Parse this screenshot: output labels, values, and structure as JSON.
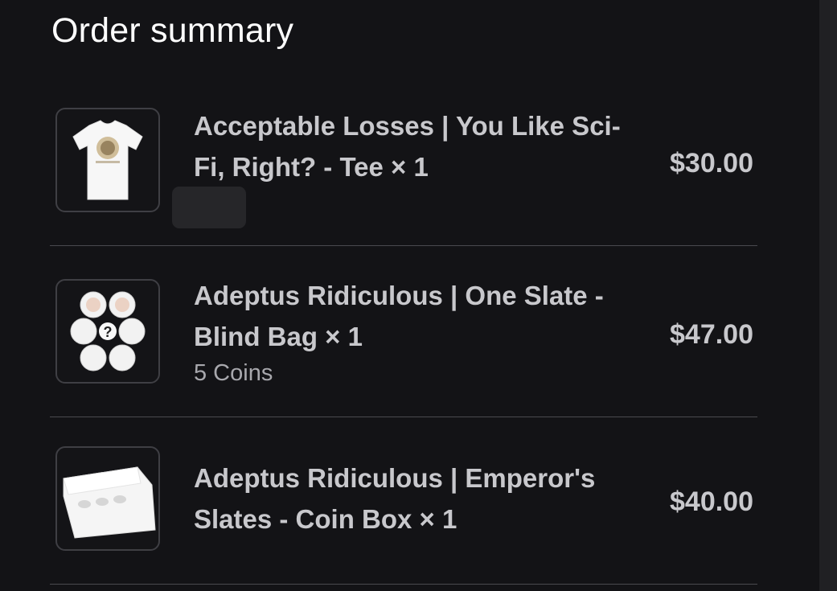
{
  "summary": {
    "title": "Order summary"
  },
  "items": [
    {
      "name": "Acceptable Losses | You Like Sci-Fi, Right? - Tee × 1",
      "variant": "",
      "price": "$30.00",
      "image_icon": "tshirt-image"
    },
    {
      "name": "Adeptus Ridiculous | One Slate - Blind Bag × 1",
      "variant": "5 Coins",
      "price": "$47.00",
      "image_icon": "coins-image"
    },
    {
      "name": "Adeptus Ridiculous | Emperor's Slates - Coin Box × 1",
      "variant": "",
      "price": "$40.00",
      "image_icon": "coin-box-image"
    }
  ],
  "colors": {
    "background": "#131316",
    "text_primary": "#ffffff",
    "text_secondary": "#c8c8cc",
    "divider": "#4a4a4f"
  }
}
